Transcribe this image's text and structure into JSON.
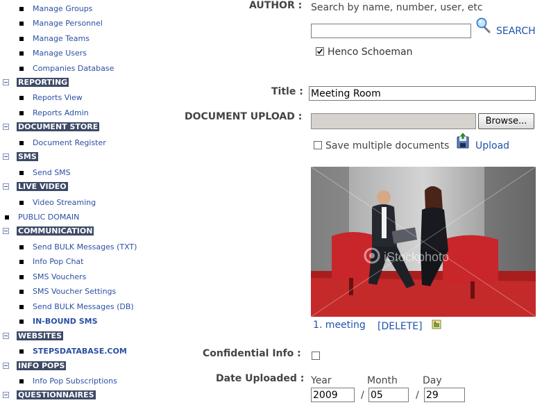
{
  "sidebar": {
    "top_items": [
      "Manage Groups",
      "Manage Personnel",
      "Manage Teams",
      "Manage Users",
      "Companies Database"
    ],
    "sections": {
      "reporting": {
        "label": "REPORTING",
        "items": [
          "Reports View",
          "Reports Admin"
        ]
      },
      "document_store": {
        "label": "DOCUMENT STORE",
        "items": [
          "Document Register"
        ]
      },
      "sms": {
        "label": "SMS",
        "items": [
          "Send SMS"
        ]
      },
      "live_video": {
        "label": "LIVE VIDEO",
        "items": [
          "Video Streaming"
        ]
      },
      "public_domain": "PUBLIC DOMAIN",
      "communication": {
        "label": "COMMUNICATION",
        "items": [
          "Send BULK Messages (TXT)",
          "Info Pop Chat",
          "SMS Vouchers",
          "SMS Voucher Settings",
          "Send BULK Messages (DB)",
          "IN-BOUND SMS"
        ]
      },
      "websites": {
        "label": "WEBSITES",
        "items": [
          "STEPSDATABASE.COM"
        ]
      },
      "info_pops": {
        "label": "INFO POPS",
        "items": [
          "Info Pop Subscriptions"
        ]
      },
      "questionnaires": {
        "label": "QUESTIONNAIRES"
      }
    }
  },
  "form": {
    "author_label": "AUTHOR :",
    "author_hint": "Search by name, number, user, etc",
    "search_value": "",
    "search_label": "SEARCH",
    "author_checked_name": "Henco Schoeman",
    "title_label": "Title :",
    "title_value": "Meeting Room",
    "upload_label": "DOCUMENT UPLOAD :",
    "browse_label": "Browse...",
    "save_multiple_label": "Save multiple documents",
    "upload_link": "Upload",
    "image_watermark": "iStockphoto",
    "attachment_name": "1. meeting",
    "delete_label": "[DELETE]",
    "confidential_label": "Confidential Info :",
    "date_label": "Date Uploaded :",
    "year_label": "Year",
    "month_label": "Month",
    "day_label": "Day",
    "year_value": "2009",
    "month_value": "05",
    "day_value": "29",
    "date_sep": "/"
  }
}
